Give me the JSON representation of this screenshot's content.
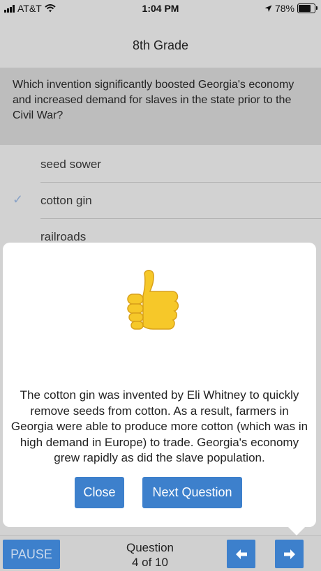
{
  "status": {
    "carrier": "AT&T",
    "time": "1:04 PM",
    "battery": "78%",
    "battery_level": 0.78
  },
  "nav": {
    "title": "8th Grade"
  },
  "question": {
    "text": "Which invention significantly boosted Georgia's economy and increased demand for slaves in the state prior to the Civil War?"
  },
  "answers": [
    {
      "label": "seed sower",
      "checked": false
    },
    {
      "label": "cotton gin",
      "checked": true
    },
    {
      "label": "railroads",
      "checked": false
    }
  ],
  "feedback": {
    "icon": "thumbs-up-icon",
    "text": "The cotton gin was invented by Eli Whitney to quickly remove seeds from cotton. As a result, farmers in Georgia were able to produce more cotton (which was in high demand in Europe) to trade. Georgia's economy grew rapidly as did the slave population.",
    "close_label": "Close",
    "next_label": "Next Question"
  },
  "footer": {
    "pause_label": "PAUSE",
    "question_label": "Question",
    "progress": "4 of 10"
  },
  "colors": {
    "accent": "#3d80cc",
    "background": "#d2d2d2",
    "question_bg": "#bdbdbd",
    "thumb": "#f6c829"
  }
}
